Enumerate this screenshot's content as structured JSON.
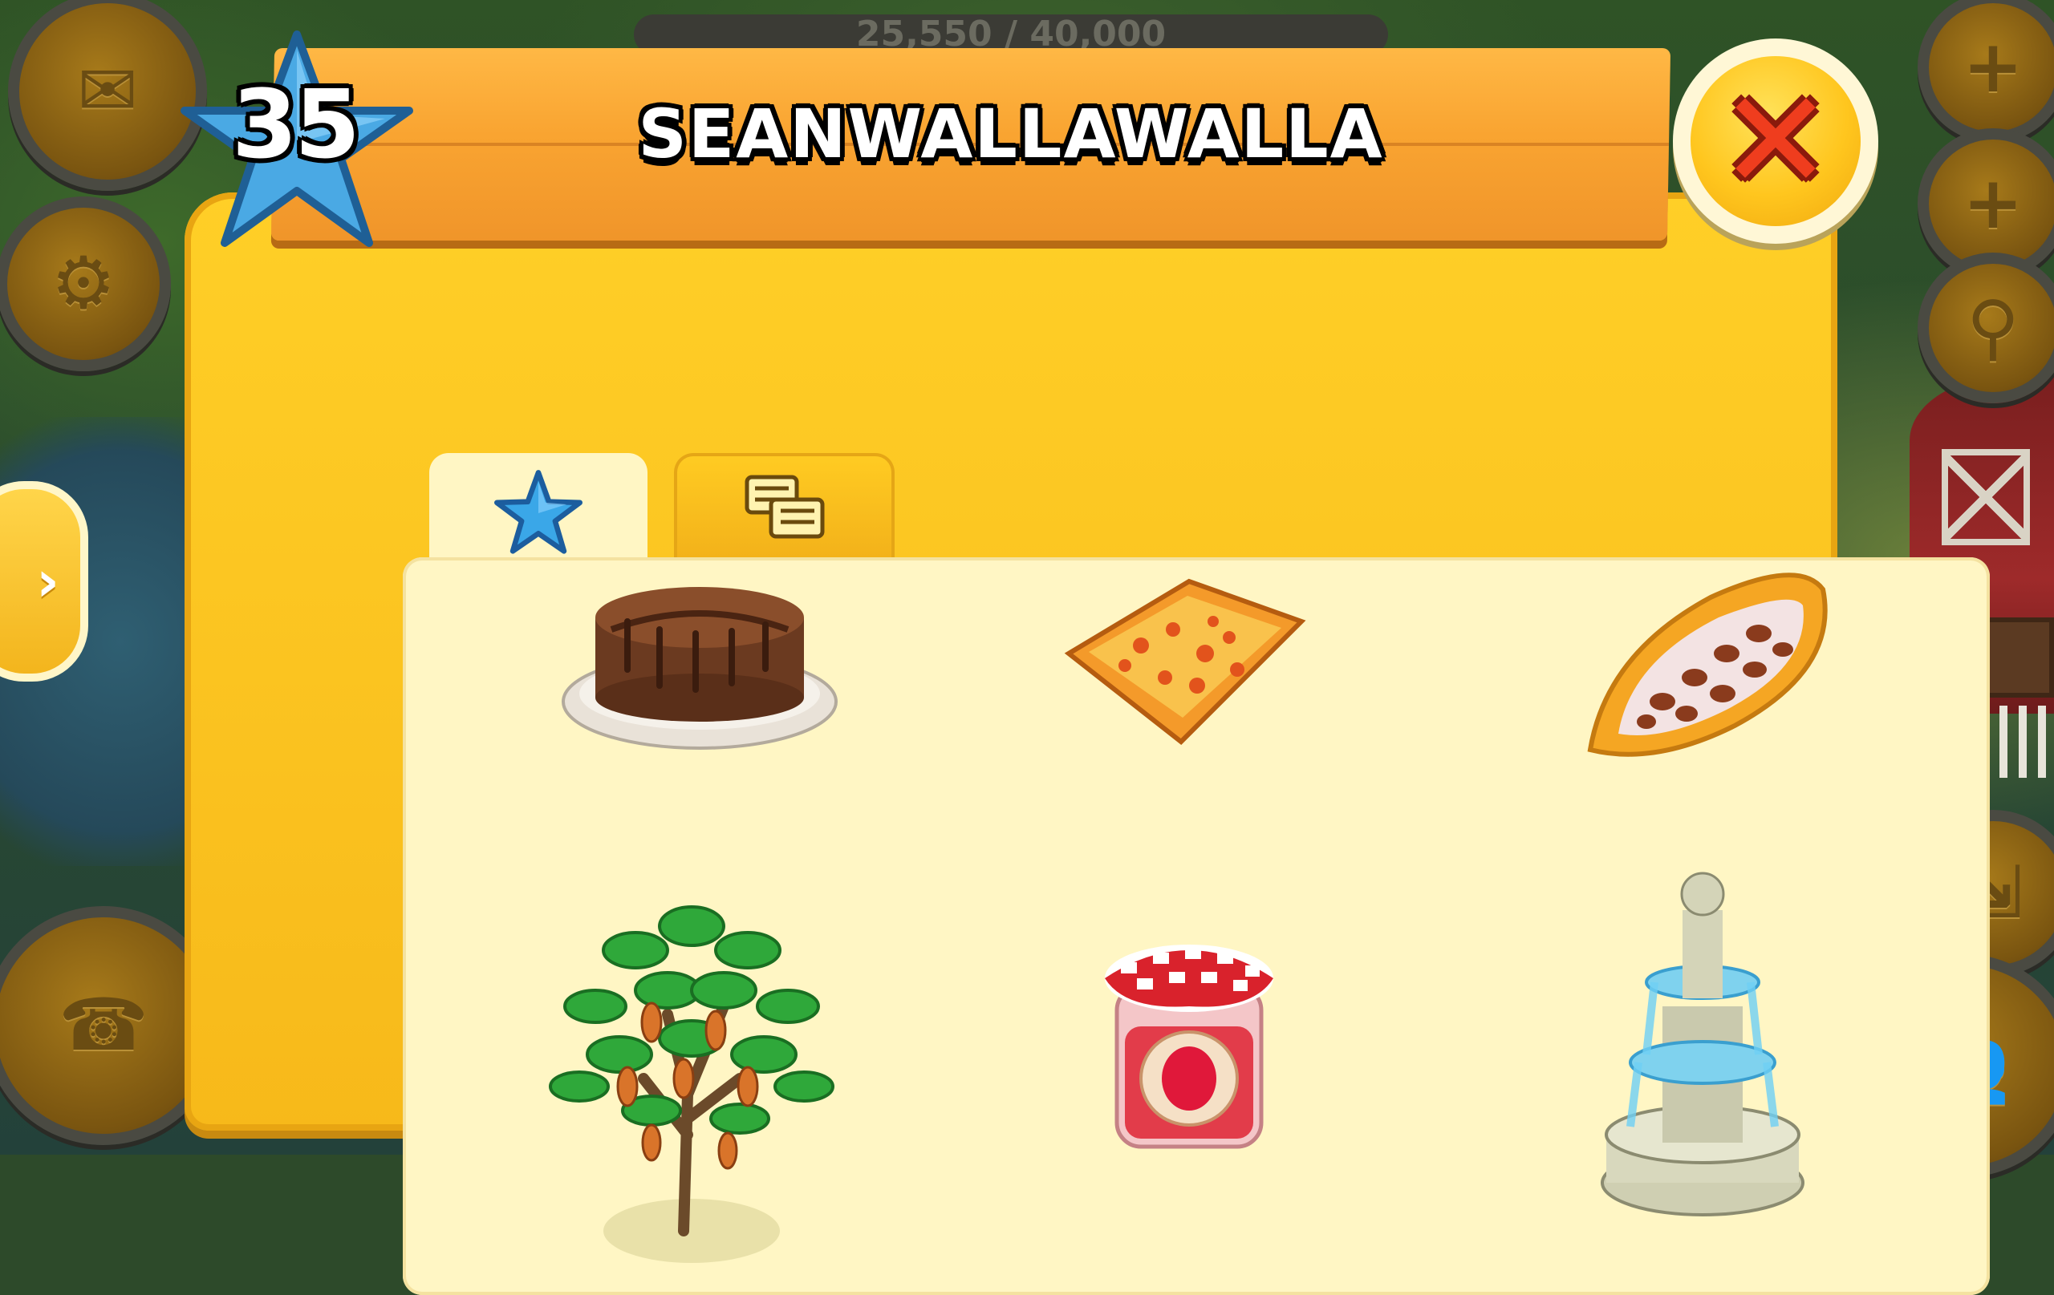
{
  "hud": {
    "top_bar_text": "25,550 / 40,000"
  },
  "side_buttons": [
    {
      "name": "mail-icon",
      "glyph": "✉"
    },
    {
      "name": "settings-gear-icon",
      "glyph": "⚙"
    },
    {
      "name": "cash-register-icon",
      "glyph": "☎"
    },
    {
      "name": "add-coins-icon",
      "glyph": "+"
    },
    {
      "name": "add-diamonds-icon",
      "glyph": "+"
    },
    {
      "name": "magnifier-icon",
      "glyph": "⚲"
    },
    {
      "name": "edit-mode-icon",
      "glyph": "⇲"
    },
    {
      "name": "friends-icon",
      "glyph": "👥"
    }
  ],
  "side_arrow": "›",
  "profile": {
    "level": "35",
    "username": "SEANWALLAWALLA"
  },
  "close_label": "✕",
  "tabs": [
    {
      "name": "favorites-tab",
      "icon": "star-icon",
      "active": true
    },
    {
      "name": "lists-tab",
      "icon": "list-cards-icon",
      "active": false
    }
  ],
  "items": [
    {
      "name": "chocolate-cake",
      "row": 1,
      "col": 1
    },
    {
      "name": "casserole-dish",
      "row": 1,
      "col": 2
    },
    {
      "name": "cacao-pod",
      "row": 1,
      "col": 3
    },
    {
      "name": "cacao-tree",
      "row": 2,
      "col": 1
    },
    {
      "name": "raspberry-jam-jar",
      "row": 2,
      "col": 2
    },
    {
      "name": "stone-fountain",
      "row": 2,
      "col": 3
    }
  ],
  "colors": {
    "panel_yellow": "#ffcf27",
    "banner_orange": "#f9a431",
    "content_cream": "#fff6c4",
    "close_red": "#ef3d1e",
    "star_blue": "#3aa7e8"
  }
}
